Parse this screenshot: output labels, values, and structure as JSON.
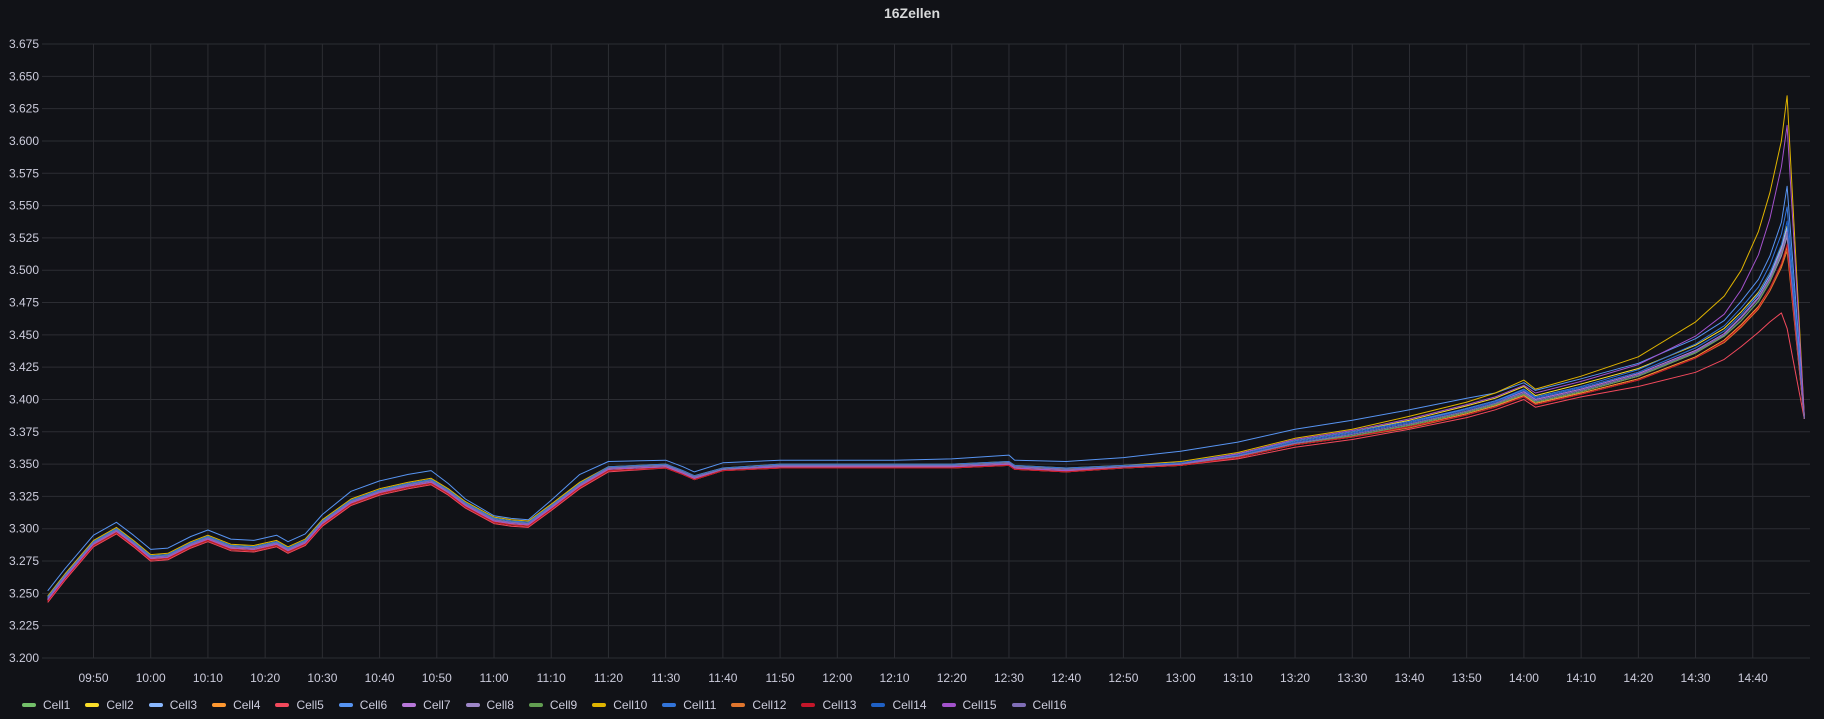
{
  "chart_data": {
    "type": "line",
    "title": "16Zellen",
    "xlabel": "",
    "ylabel": "",
    "grid": true,
    "legend_placement": "bottom-left",
    "ylim": [
      3.2,
      3.675
    ],
    "y_ticks": [
      "3.200",
      "3.225",
      "3.250",
      "3.275",
      "3.300",
      "3.325",
      "3.350",
      "3.375",
      "3.400",
      "3.425",
      "3.450",
      "3.475",
      "3.500",
      "3.525",
      "3.550",
      "3.575",
      "3.600",
      "3.625",
      "3.650",
      "3.675"
    ],
    "x_ticks": [
      "09:50",
      "10:00",
      "10:10",
      "10:20",
      "10:30",
      "10:40",
      "10:50",
      "11:00",
      "11:10",
      "11:20",
      "11:30",
      "11:40",
      "11:50",
      "12:00",
      "12:10",
      "12:20",
      "12:30",
      "12:40",
      "12:50",
      "13:00",
      "13:10",
      "13:20",
      "13:30",
      "13:40",
      "13:50",
      "14:00",
      "14:10",
      "14:20",
      "14:30",
      "14:40"
    ],
    "xlim": [
      "09:41",
      "14:50"
    ],
    "x": [
      "09:42",
      "09:45",
      "09:50",
      "09:54",
      "09:57",
      "10:00",
      "10:03",
      "10:07",
      "10:10",
      "10:14",
      "10:18",
      "10:22",
      "10:24",
      "10:27",
      "10:30",
      "10:35",
      "10:40",
      "10:45",
      "10:49",
      "10:52",
      "10:55",
      "11:00",
      "11:03",
      "11:06",
      "11:10",
      "11:15",
      "11:20",
      "11:30",
      "11:33",
      "11:35",
      "11:40",
      "11:50",
      "12:00",
      "12:10",
      "12:20",
      "12:30",
      "12:31",
      "12:40",
      "12:50",
      "13:00",
      "13:10",
      "13:20",
      "13:30",
      "13:40",
      "13:50",
      "13:55",
      "14:00",
      "14:02",
      "14:10",
      "14:20",
      "14:30",
      "14:35",
      "14:38",
      "14:41",
      "14:43",
      "14:45",
      "14:46",
      "14:49"
    ],
    "series": [
      {
        "name": "Cell1",
        "color": "#73bf69",
        "values": [
          3.247,
          3.264,
          3.29,
          3.3,
          3.29,
          3.279,
          3.28,
          3.289,
          3.294,
          3.287,
          3.286,
          3.29,
          3.285,
          3.291,
          3.306,
          3.322,
          3.33,
          3.335,
          3.338,
          3.33,
          3.32,
          3.308,
          3.306,
          3.305,
          3.318,
          3.335,
          3.347,
          3.349,
          3.344,
          3.34,
          3.346,
          3.349,
          3.349,
          3.349,
          3.349,
          3.351,
          3.348,
          3.346,
          3.348,
          3.35,
          3.356,
          3.366,
          3.372,
          3.38,
          3.39,
          3.396,
          3.404,
          3.398,
          3.406,
          3.418,
          3.436,
          3.449,
          3.461,
          3.476,
          3.491,
          3.512,
          3.527,
          3.385
        ]
      },
      {
        "name": "Cell2",
        "color": "#fade2a",
        "values": [
          3.245,
          3.262,
          3.288,
          3.298,
          3.288,
          3.277,
          3.278,
          3.287,
          3.292,
          3.285,
          3.284,
          3.288,
          3.283,
          3.289,
          3.304,
          3.32,
          3.328,
          3.333,
          3.336,
          3.328,
          3.318,
          3.306,
          3.304,
          3.303,
          3.316,
          3.333,
          3.346,
          3.348,
          3.343,
          3.339,
          3.346,
          3.348,
          3.348,
          3.348,
          3.348,
          3.35,
          3.347,
          3.345,
          3.348,
          3.35,
          3.358,
          3.368,
          3.375,
          3.384,
          3.395,
          3.401,
          3.41,
          3.403,
          3.412,
          3.424,
          3.442,
          3.455,
          3.468,
          3.483,
          3.498,
          3.519,
          3.534,
          3.385
        ]
      },
      {
        "name": "Cell3",
        "color": "#8ab8ff",
        "values": [
          3.246,
          3.263,
          3.289,
          3.299,
          3.289,
          3.278,
          3.279,
          3.288,
          3.293,
          3.286,
          3.285,
          3.289,
          3.284,
          3.29,
          3.305,
          3.321,
          3.329,
          3.334,
          3.337,
          3.329,
          3.319,
          3.307,
          3.305,
          3.304,
          3.317,
          3.334,
          3.347,
          3.349,
          3.344,
          3.34,
          3.346,
          3.349,
          3.349,
          3.349,
          3.349,
          3.351,
          3.348,
          3.346,
          3.348,
          3.351,
          3.357,
          3.367,
          3.374,
          3.382,
          3.393,
          3.399,
          3.407,
          3.401,
          3.409,
          3.421,
          3.44,
          3.453,
          3.466,
          3.481,
          3.496,
          3.517,
          3.533,
          3.385
        ]
      },
      {
        "name": "Cell4",
        "color": "#ff9830",
        "values": [
          3.244,
          3.261,
          3.287,
          3.297,
          3.287,
          3.276,
          3.277,
          3.286,
          3.291,
          3.284,
          3.283,
          3.287,
          3.282,
          3.288,
          3.303,
          3.319,
          3.327,
          3.332,
          3.335,
          3.327,
          3.317,
          3.305,
          3.303,
          3.302,
          3.315,
          3.332,
          3.345,
          3.347,
          3.342,
          3.338,
          3.345,
          3.347,
          3.347,
          3.347,
          3.347,
          3.349,
          3.346,
          3.344,
          3.347,
          3.349,
          3.355,
          3.365,
          3.371,
          3.379,
          3.389,
          3.395,
          3.403,
          3.397,
          3.405,
          3.416,
          3.433,
          3.446,
          3.458,
          3.472,
          3.486,
          3.504,
          3.518,
          3.385
        ]
      },
      {
        "name": "Cell5",
        "color": "#f2495c",
        "values": [
          3.243,
          3.26,
          3.286,
          3.296,
          3.286,
          3.275,
          3.276,
          3.285,
          3.29,
          3.283,
          3.282,
          3.286,
          3.281,
          3.287,
          3.302,
          3.318,
          3.326,
          3.331,
          3.334,
          3.326,
          3.316,
          3.304,
          3.302,
          3.301,
          3.314,
          3.331,
          3.344,
          3.347,
          3.342,
          3.338,
          3.345,
          3.347,
          3.347,
          3.347,
          3.347,
          3.349,
          3.346,
          3.344,
          3.347,
          3.349,
          3.354,
          3.363,
          3.369,
          3.377,
          3.386,
          3.392,
          3.4,
          3.394,
          3.402,
          3.41,
          3.421,
          3.431,
          3.441,
          3.452,
          3.46,
          3.467,
          3.455,
          3.385
        ]
      },
      {
        "name": "Cell6",
        "color": "#5794f2",
        "values": [
          3.252,
          3.269,
          3.295,
          3.305,
          3.295,
          3.284,
          3.285,
          3.294,
          3.299,
          3.292,
          3.291,
          3.295,
          3.29,
          3.296,
          3.311,
          3.329,
          3.337,
          3.342,
          3.345,
          3.335,
          3.323,
          3.31,
          3.308,
          3.307,
          3.322,
          3.342,
          3.352,
          3.353,
          3.348,
          3.344,
          3.351,
          3.353,
          3.353,
          3.353,
          3.354,
          3.357,
          3.353,
          3.352,
          3.355,
          3.36,
          3.367,
          3.377,
          3.384,
          3.392,
          3.401,
          3.405,
          3.413,
          3.407,
          3.416,
          3.428,
          3.447,
          3.461,
          3.476,
          3.493,
          3.511,
          3.537,
          3.565,
          3.388
        ]
      },
      {
        "name": "Cell7",
        "color": "#b877d9",
        "values": [
          3.246,
          3.263,
          3.289,
          3.299,
          3.289,
          3.278,
          3.279,
          3.288,
          3.293,
          3.286,
          3.285,
          3.289,
          3.284,
          3.29,
          3.305,
          3.321,
          3.329,
          3.334,
          3.337,
          3.329,
          3.319,
          3.307,
          3.305,
          3.304,
          3.317,
          3.334,
          3.347,
          3.349,
          3.344,
          3.34,
          3.346,
          3.349,
          3.349,
          3.349,
          3.349,
          3.351,
          3.348,
          3.346,
          3.348,
          3.35,
          3.357,
          3.367,
          3.374,
          3.382,
          3.392,
          3.398,
          3.406,
          3.4,
          3.408,
          3.42,
          3.438,
          3.451,
          3.464,
          3.479,
          3.494,
          3.515,
          3.53,
          3.385
        ]
      },
      {
        "name": "Cell8",
        "color": "#9e86c8",
        "values": [
          3.245,
          3.262,
          3.288,
          3.298,
          3.288,
          3.277,
          3.278,
          3.287,
          3.292,
          3.285,
          3.284,
          3.288,
          3.283,
          3.289,
          3.304,
          3.32,
          3.328,
          3.333,
          3.336,
          3.328,
          3.318,
          3.306,
          3.304,
          3.303,
          3.316,
          3.333,
          3.346,
          3.348,
          3.343,
          3.339,
          3.346,
          3.348,
          3.348,
          3.348,
          3.348,
          3.35,
          3.347,
          3.345,
          3.347,
          3.35,
          3.356,
          3.366,
          3.372,
          3.38,
          3.39,
          3.396,
          3.404,
          3.398,
          3.406,
          3.418,
          3.436,
          3.449,
          3.461,
          3.476,
          3.491,
          3.511,
          3.526,
          3.385
        ]
      },
      {
        "name": "Cell9",
        "color": "#629e51",
        "values": [
          3.247,
          3.264,
          3.29,
          3.3,
          3.29,
          3.279,
          3.28,
          3.289,
          3.294,
          3.287,
          3.286,
          3.29,
          3.285,
          3.291,
          3.306,
          3.322,
          3.33,
          3.335,
          3.338,
          3.33,
          3.32,
          3.308,
          3.306,
          3.305,
          3.318,
          3.335,
          3.347,
          3.349,
          3.344,
          3.34,
          3.346,
          3.349,
          3.349,
          3.349,
          3.349,
          3.351,
          3.348,
          3.346,
          3.348,
          3.35,
          3.356,
          3.366,
          3.372,
          3.38,
          3.39,
          3.396,
          3.404,
          3.398,
          3.406,
          3.418,
          3.436,
          3.449,
          3.461,
          3.476,
          3.491,
          3.513,
          3.529,
          3.385
        ]
      },
      {
        "name": "Cell10",
        "color": "#e0b400",
        "values": [
          3.248,
          3.265,
          3.291,
          3.301,
          3.291,
          3.28,
          3.281,
          3.29,
          3.295,
          3.288,
          3.287,
          3.291,
          3.286,
          3.292,
          3.307,
          3.323,
          3.331,
          3.336,
          3.339,
          3.331,
          3.321,
          3.309,
          3.307,
          3.306,
          3.319,
          3.336,
          3.348,
          3.35,
          3.345,
          3.341,
          3.347,
          3.35,
          3.35,
          3.35,
          3.35,
          3.352,
          3.349,
          3.347,
          3.349,
          3.352,
          3.359,
          3.37,
          3.377,
          3.387,
          3.398,
          3.405,
          3.415,
          3.408,
          3.418,
          3.433,
          3.46,
          3.48,
          3.5,
          3.53,
          3.56,
          3.6,
          3.635,
          3.387
        ]
      },
      {
        "name": "Cell11",
        "color": "#3274d9",
        "values": [
          3.247,
          3.264,
          3.29,
          3.3,
          3.29,
          3.279,
          3.28,
          3.289,
          3.294,
          3.287,
          3.286,
          3.29,
          3.285,
          3.291,
          3.306,
          3.322,
          3.33,
          3.335,
          3.338,
          3.33,
          3.32,
          3.308,
          3.306,
          3.305,
          3.318,
          3.335,
          3.348,
          3.35,
          3.345,
          3.341,
          3.347,
          3.35,
          3.35,
          3.35,
          3.35,
          3.352,
          3.349,
          3.347,
          3.349,
          3.351,
          3.358,
          3.368,
          3.375,
          3.383,
          3.393,
          3.399,
          3.408,
          3.402,
          3.41,
          3.423,
          3.443,
          3.457,
          3.471,
          3.487,
          3.504,
          3.528,
          3.549,
          3.386
        ]
      },
      {
        "name": "Cell12",
        "color": "#e0752d",
        "values": [
          3.245,
          3.262,
          3.288,
          3.298,
          3.288,
          3.277,
          3.278,
          3.287,
          3.292,
          3.285,
          3.284,
          3.288,
          3.283,
          3.289,
          3.304,
          3.32,
          3.328,
          3.333,
          3.336,
          3.328,
          3.318,
          3.306,
          3.304,
          3.303,
          3.316,
          3.333,
          3.346,
          3.348,
          3.343,
          3.339,
          3.346,
          3.348,
          3.348,
          3.348,
          3.348,
          3.35,
          3.347,
          3.345,
          3.347,
          3.349,
          3.355,
          3.365,
          3.371,
          3.378,
          3.388,
          3.394,
          3.402,
          3.396,
          3.404,
          3.415,
          3.432,
          3.444,
          3.456,
          3.47,
          3.484,
          3.502,
          3.515,
          3.385
        ]
      },
      {
        "name": "Cell13",
        "color": "#c4162a",
        "values": [
          3.244,
          3.261,
          3.287,
          3.297,
          3.287,
          3.276,
          3.277,
          3.286,
          3.291,
          3.284,
          3.283,
          3.287,
          3.282,
          3.288,
          3.303,
          3.319,
          3.327,
          3.332,
          3.335,
          3.327,
          3.317,
          3.305,
          3.303,
          3.302,
          3.315,
          3.332,
          3.345,
          3.347,
          3.342,
          3.338,
          3.345,
          3.347,
          3.347,
          3.347,
          3.347,
          3.349,
          3.346,
          3.344,
          3.347,
          3.349,
          3.355,
          3.365,
          3.371,
          3.379,
          3.388,
          3.394,
          3.402,
          3.396,
          3.404,
          3.415,
          3.432,
          3.445,
          3.457,
          3.471,
          3.486,
          3.505,
          3.52,
          3.385
        ]
      },
      {
        "name": "Cell14",
        "color": "#1f60c4",
        "values": [
          3.246,
          3.263,
          3.289,
          3.299,
          3.289,
          3.278,
          3.279,
          3.288,
          3.293,
          3.286,
          3.285,
          3.289,
          3.284,
          3.29,
          3.305,
          3.321,
          3.329,
          3.334,
          3.337,
          3.329,
          3.319,
          3.307,
          3.305,
          3.304,
          3.317,
          3.334,
          3.347,
          3.349,
          3.344,
          3.34,
          3.346,
          3.349,
          3.349,
          3.349,
          3.349,
          3.351,
          3.348,
          3.346,
          3.348,
          3.351,
          3.357,
          3.367,
          3.374,
          3.382,
          3.392,
          3.398,
          3.407,
          3.401,
          3.409,
          3.421,
          3.44,
          3.453,
          3.466,
          3.482,
          3.498,
          3.52,
          3.538,
          3.386
        ]
      },
      {
        "name": "Cell15",
        "color": "#a352cc",
        "values": [
          3.245,
          3.262,
          3.288,
          3.298,
          3.288,
          3.277,
          3.278,
          3.287,
          3.292,
          3.285,
          3.284,
          3.288,
          3.283,
          3.289,
          3.304,
          3.32,
          3.328,
          3.333,
          3.336,
          3.328,
          3.318,
          3.306,
          3.304,
          3.303,
          3.316,
          3.333,
          3.346,
          3.348,
          3.343,
          3.339,
          3.346,
          3.348,
          3.348,
          3.348,
          3.348,
          3.35,
          3.347,
          3.345,
          3.348,
          3.35,
          3.358,
          3.369,
          3.376,
          3.385,
          3.396,
          3.402,
          3.411,
          3.405,
          3.414,
          3.427,
          3.449,
          3.466,
          3.485,
          3.512,
          3.54,
          3.58,
          3.612,
          3.387
        ]
      },
      {
        "name": "Cell16",
        "color": "#806eb7",
        "values": [
          3.246,
          3.263,
          3.289,
          3.299,
          3.289,
          3.278,
          3.279,
          3.288,
          3.293,
          3.286,
          3.285,
          3.289,
          3.284,
          3.29,
          3.305,
          3.321,
          3.329,
          3.334,
          3.337,
          3.329,
          3.319,
          3.307,
          3.305,
          3.304,
          3.317,
          3.334,
          3.347,
          3.349,
          3.344,
          3.34,
          3.346,
          3.349,
          3.349,
          3.349,
          3.349,
          3.351,
          3.348,
          3.346,
          3.348,
          3.35,
          3.356,
          3.366,
          3.373,
          3.381,
          3.391,
          3.397,
          3.405,
          3.399,
          3.407,
          3.419,
          3.437,
          3.45,
          3.463,
          3.478,
          3.493,
          3.514,
          3.529,
          3.385
        ]
      }
    ]
  },
  "colors": {
    "background": "#111217",
    "grid": "#2c2d33",
    "axis_text": "#ccccdc",
    "title_text": "#d8d9da"
  }
}
